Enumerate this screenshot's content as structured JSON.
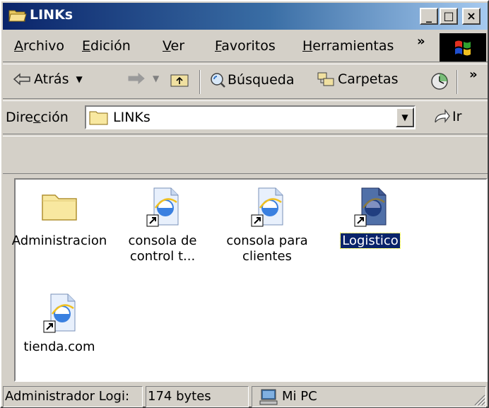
{
  "window": {
    "title": "LINKs",
    "buttons": {
      "minimize": "_",
      "maximize": "□",
      "close": "×"
    }
  },
  "menu": {
    "items": [
      {
        "label": "Archivo",
        "accel": "A",
        "rest": "rchivo"
      },
      {
        "label": "Edición",
        "accel": "E",
        "rest": "dición"
      },
      {
        "label": "Ver",
        "accel": "V",
        "rest": "er"
      },
      {
        "label": "Favoritos",
        "accel": "F",
        "rest": "avoritos"
      },
      {
        "label": "Herramientas",
        "accel": "H",
        "rest": "erramientas"
      }
    ],
    "overflow": "»"
  },
  "toolbar": {
    "back_label": "Atrás",
    "search_label": "Búsqueda",
    "folders_label": "Carpetas",
    "overflow": "»"
  },
  "address": {
    "label_pre": "Dire",
    "label_accel": "c",
    "label_post": "ción",
    "value": "LINKs",
    "go_label": "Ir"
  },
  "content": {
    "items": [
      {
        "label_line1": "Administracion",
        "label_line2": "",
        "type": "folder",
        "selected": false
      },
      {
        "label_line1": "consola de",
        "label_line2": "control t...",
        "type": "ie-shortcut",
        "selected": false
      },
      {
        "label_line1": "consola para",
        "label_line2": "clientes",
        "type": "ie-shortcut",
        "selected": false
      },
      {
        "label_line1": "Logistico",
        "label_line2": "",
        "type": "ie-shortcut",
        "selected": true
      },
      {
        "label_line1": "tienda.com",
        "label_line2": "",
        "type": "ie-shortcut",
        "selected": false
      }
    ]
  },
  "status": {
    "cell1": "Administrador Logi:",
    "cell2": "174 bytes",
    "cell3": "Mi PC"
  },
  "colors": {
    "face": "#d4d0c8",
    "title_active": "#0a246a",
    "selection": "#0a246a"
  }
}
